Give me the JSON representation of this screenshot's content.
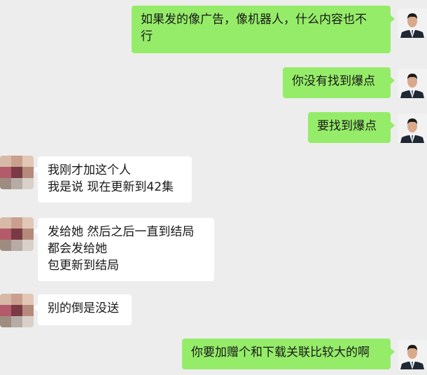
{
  "theme": {
    "outgoing_bubble": "#95ec69",
    "incoming_bubble": "#ffffff",
    "background": "#ededed"
  },
  "messages": [
    {
      "direction": "out",
      "text": "如果发的像广告，像机器人，什么内容也不\n行"
    },
    {
      "direction": "out",
      "text": "你没有找到爆点"
    },
    {
      "direction": "out",
      "text": "要找到爆点"
    },
    {
      "direction": "in",
      "text": "我刚才加这个人\n我是说  现在更新到42集"
    },
    {
      "direction": "in",
      "text": "发给她  然后之后一直到结局\n都会发给她\n包更新到结局"
    },
    {
      "direction": "in",
      "text": "别的倒是没送"
    },
    {
      "direction": "out",
      "text": "你要加赠个和下载关联比较大的啊"
    }
  ],
  "avatars": {
    "me": "man-in-suit-avatar",
    "other": "pixelated-avatar"
  }
}
